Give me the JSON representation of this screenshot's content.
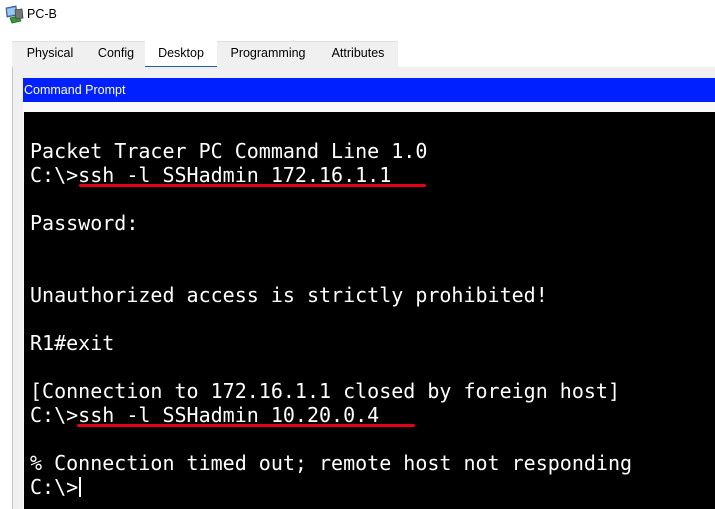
{
  "window": {
    "title": "PC-B",
    "icon": "packet-tracer-pc-icon"
  },
  "tabs": [
    {
      "label": "Physical",
      "active": false
    },
    {
      "label": "Config",
      "active": false
    },
    {
      "label": "Desktop",
      "active": true
    },
    {
      "label": "Programming",
      "active": false
    },
    {
      "label": "Attributes",
      "active": false
    }
  ],
  "command_prompt": {
    "header": "Command Prompt",
    "lines": [
      "Packet Tracer PC Command Line 1.0",
      "C:\\>ssh -l SSHadmin 172.16.1.1",
      "",
      "Password:",
      "",
      "",
      "Unauthorized access is strictly prohibited!",
      "",
      "R1#exit",
      "",
      "[Connection to 172.16.1.1 closed by foreign host]",
      "C:\\>ssh -l SSHadmin 10.20.0.4",
      "",
      "% Connection timed out; remote host not responding",
      "C:\\>"
    ]
  },
  "colors": {
    "header_bg": "#0020ff",
    "terminal_bg": "#000000",
    "terminal_text": "#ffffff",
    "annotation_underline": "#e5001a",
    "active_tab_indicator": "#1c5fa8"
  }
}
